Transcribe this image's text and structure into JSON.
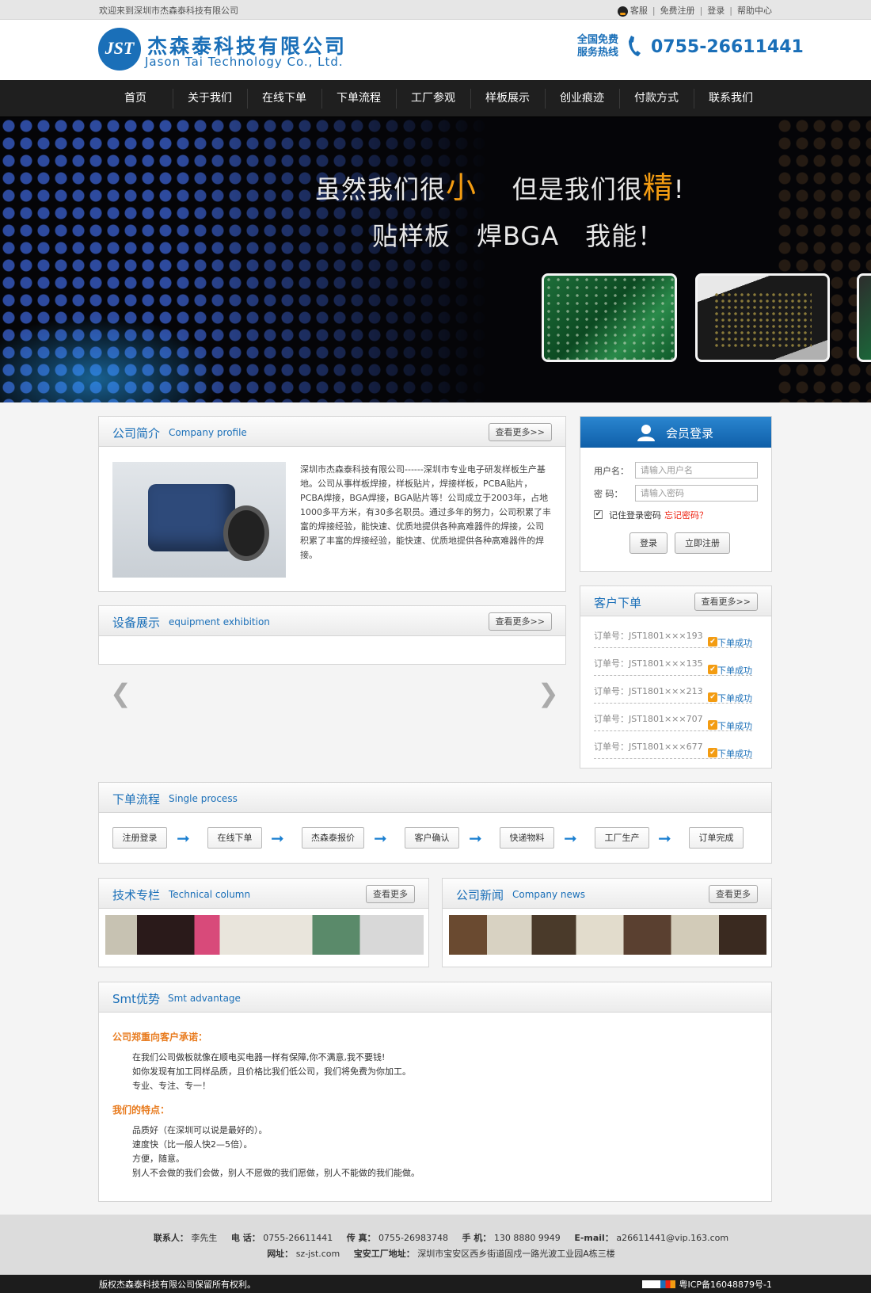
{
  "topbar": {
    "welcome": "欢迎来到深圳市杰森泰科技有限公司",
    "links": [
      "客服",
      "免费注册",
      "登录",
      "帮助中心"
    ]
  },
  "header": {
    "logo_mark": "JST",
    "logo_cn": "杰森泰科技有限公司",
    "logo_en": "Jason Tai Technology Co., Ltd.",
    "hotline_label": "全国免费 服务热线",
    "hotline": "0755-26611441"
  },
  "nav": {
    "items": [
      "首页",
      "关于我们",
      "在线下单",
      "下单流程",
      "工厂参观",
      "样板展示",
      "创业痕迹",
      "付款方式",
      "联系我们"
    ]
  },
  "banner": {
    "line1_a": "虽然我们很",
    "line1_b": "小",
    "line1_c": "但是我们很",
    "line1_d": "精",
    "line1_e": "!",
    "line2": "贴样板　焊BGA　我能！"
  },
  "profile": {
    "title_cn": "公司简介",
    "title_en": "Company profile",
    "more": "查看更多>>",
    "text": "深圳市杰森泰科技有限公司------深圳市专业电子研发样板生产基地。公司从事样板焊接，样板贴片，焊接样板，PCBA贴片，PCBA焊接，BGA焊接，BGA贴片等！公司成立于2003年，占地1000多平方米，有30多名职员。通过多年的努力，公司积累了丰富的焊接经验，能快速、优质地提供各种高难器件的焊接，公司积累了丰富的焊接经验，能快速、优质地提供各种高难器件的焊接。"
  },
  "equipment": {
    "title_cn": "设备展示",
    "title_en": "equipment exhibition",
    "more": "查看更多>>",
    "prev": "❮",
    "next": "❯"
  },
  "login": {
    "title": "会员登录",
    "user_label": "用户名：",
    "user_placeholder": "请输入用户名",
    "pass_label": "密 码：",
    "pass_placeholder": "请输入密码",
    "remember": "记住登录密码",
    "forgot": "忘记密码？",
    "login_btn": "登录",
    "register_btn": "立即注册"
  },
  "orders": {
    "title": "客户下单",
    "more": "查看更多>>",
    "items": [
      {
        "no": "订单号：JST1801×××193",
        "status": "下单成功"
      },
      {
        "no": "订单号：JST1801×××135",
        "status": "下单成功"
      },
      {
        "no": "订单号：JST1801×××213",
        "status": "下单成功"
      },
      {
        "no": "订单号：JST1801×××707",
        "status": "下单成功"
      },
      {
        "no": "订单号：JST1801×××677",
        "status": "下单成功"
      }
    ]
  },
  "process": {
    "title_cn": "下单流程",
    "title_en": "Single process",
    "steps": [
      "注册登录",
      "在线下单",
      "杰森泰报价",
      "客户确认",
      "快递物料",
      "工厂生产",
      "订单完成"
    ],
    "arrow": "➞"
  },
  "tech": {
    "title_cn": "技术专栏",
    "title_en": "Technical column",
    "more": "查看更多"
  },
  "news": {
    "title_cn": "公司新闻",
    "title_en": "Company news",
    "more": "查看更多"
  },
  "smt": {
    "title_cn": "Smt优势",
    "title_en": "Smt advantage",
    "h1": "公司郑重向客户承诺：",
    "p1": [
      "在我们公司做板就像在顺电买电器一样有保障,你不满意,我不要钱!",
      "如你发现有加工同样品质，且价格比我们低公司，我们将免费为你加工。",
      "专业、专注、专一！"
    ],
    "h2": "我们的特点：",
    "p2": [
      "品质好（在深圳可以说是最好的）。",
      "速度快（比一般人快2—5倍）。",
      "方便，随意。",
      "别人不会做的我们会做，别人不愿做的我们愿做，别人不能做的我们能做。"
    ]
  },
  "footer": {
    "contact_label": "联系人：",
    "contact": "李先生",
    "tel_label": "电 话：",
    "tel": "0755-26611441",
    "fax_label": "传 真：",
    "fax": "0755-26983748",
    "mobile_label": "手 机：",
    "mobile": "130 8880 9949",
    "email_label": "E-mail：",
    "email": "a26611441@vip.163.com",
    "site_label": "网址：",
    "site": "sz-jst.com",
    "addr_label": "宝安工厂地址：",
    "addr": "深圳市宝安区西乡街道固戍一路光波工业园A栋三楼"
  },
  "copyright": {
    "left": "版权杰森泰科技有限公司保留所有权利。",
    "icp": "粤ICP备16048879号-1"
  },
  "colors": {
    "brand": "#1a6fb8",
    "accent": "#f39c12",
    "nav_bg": "#1f1f1f"
  }
}
